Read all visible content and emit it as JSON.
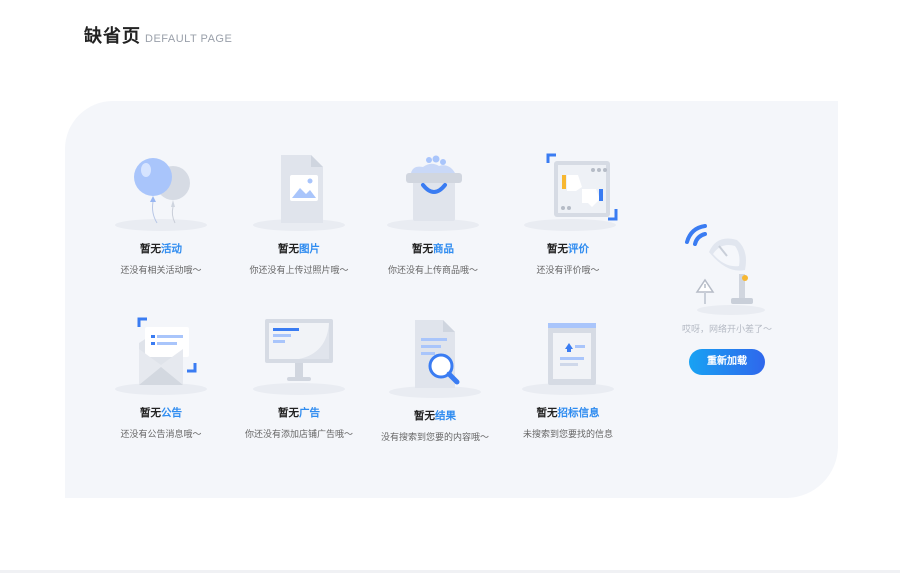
{
  "header": {
    "title": "缺省页",
    "subtitle": "DEFAULT PAGE"
  },
  "cards": [
    {
      "prefix": "暂无",
      "highlight": "活动",
      "desc": "还没有相关活动哦～",
      "icon": "balloon-icon"
    },
    {
      "prefix": "暂无",
      "highlight": "图片",
      "desc": "你还没有上传过照片哦～",
      "icon": "image-file-icon"
    },
    {
      "prefix": "暂无",
      "highlight": "商品",
      "desc": "你还没有上传商品哦～",
      "icon": "shopping-basket-icon"
    },
    {
      "prefix": "暂无",
      "highlight": "评价",
      "desc": "还没有评价哦～",
      "icon": "thumbs-review-icon"
    },
    {
      "prefix": "暂无",
      "highlight": "公告",
      "desc": "还没有公告消息哦～",
      "icon": "envelope-icon"
    },
    {
      "prefix": "暂无",
      "highlight": "广告",
      "desc": "你还没有添加店铺广告哦～",
      "icon": "monitor-icon"
    },
    {
      "prefix": "暂无",
      "highlight": "结果",
      "desc": "没有搜索到您要的内容哦～",
      "icon": "search-document-icon"
    },
    {
      "prefix": "暂无",
      "highlight": "招标信息",
      "desc": "未搜索到您要找的信息",
      "icon": "bidding-board-icon"
    }
  ],
  "network": {
    "message": "哎呀，网络开小差了～",
    "button": "重新加载",
    "icon": "satellite-dish-icon"
  },
  "colors": {
    "accent": "#2f8cf0",
    "panel": "#f4f6fa",
    "button_from": "#18a2f3",
    "button_to": "#2f67ec"
  }
}
